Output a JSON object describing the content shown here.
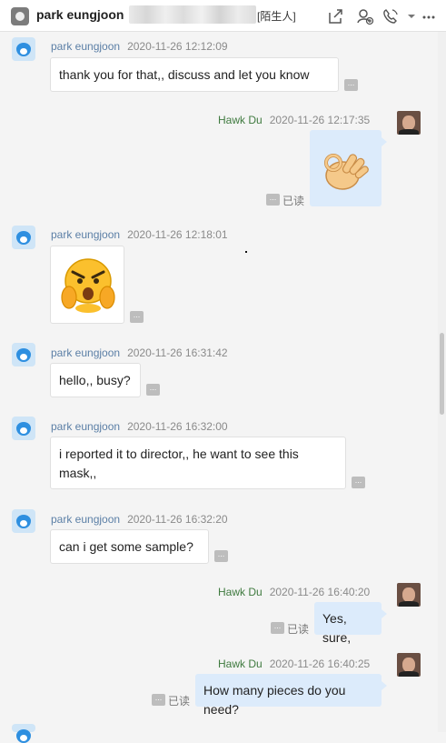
{
  "header": {
    "contact_name": "park eungjoon",
    "tag": "[陌生人]",
    "icons": [
      "share-icon",
      "add-contact-icon",
      "call-icon",
      "dropdown-icon",
      "more-icon"
    ]
  },
  "labels": {
    "read": "已读",
    "more": "..."
  },
  "messages": [
    {
      "sender": "park eungjoon",
      "time": "2020-11-26 12:12:09",
      "side": "left",
      "text": "thank you for that,, discuss and let you know"
    },
    {
      "sender": "Hawk Du",
      "time": "2020-11-26 12:17:35",
      "side": "right",
      "type": "sticker",
      "sticker": "ok-hand-icon",
      "status": "已读"
    },
    {
      "sender": "park eungjoon",
      "time": "2020-11-26 12:18:01",
      "side": "left",
      "type": "sticker",
      "sticker": "angry-emoji-icon"
    },
    {
      "sender": "park eungjoon",
      "time": "2020-11-26 16:31:42",
      "side": "left",
      "text": "hello,, busy?"
    },
    {
      "sender": "park eungjoon",
      "time": "2020-11-26 16:32:00",
      "side": "left",
      "text_line1": "i reported it to director,, he want to see this",
      "text_line2": "mask,,"
    },
    {
      "sender": "park eungjoon",
      "time": "2020-11-26 16:32:20",
      "side": "left",
      "text": "can i get some sample?"
    },
    {
      "sender": "Hawk Du",
      "time": "2020-11-26 16:40:20",
      "side": "right",
      "text": "Yes, sure,",
      "status": "已读"
    },
    {
      "sender": "Hawk Du",
      "time": "2020-11-26 16:40:25",
      "side": "right",
      "text": "How many pieces do you need?",
      "status": "已读"
    }
  ],
  "colors": {
    "header_bg": "#ffffff",
    "chat_bg": "#f4f4f4",
    "left_bubble": "#ffffff",
    "right_bubble": "#dcebfb",
    "left_name": "#5b7fa6",
    "right_name": "#3f7a3f"
  }
}
